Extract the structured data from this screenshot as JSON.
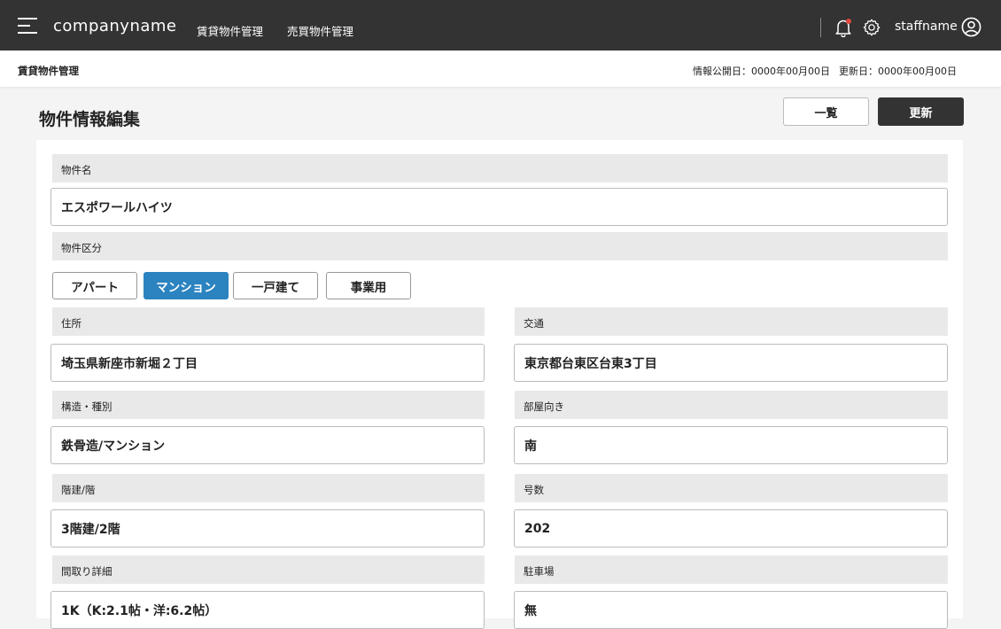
{
  "header": {
    "brand": "companyname",
    "nav": [
      "賃貸物件管理",
      "売買物件管理"
    ],
    "staff_name": "staffname"
  },
  "subheader": {
    "breadcrumb": "賃貸物件管理",
    "published": "情報公開日：0000年00月00日",
    "updated": "更新日：0000年00月00日"
  },
  "page": {
    "title": "物件情報編集",
    "list_button": "一覧",
    "update_button": "更新"
  },
  "form": {
    "name_label": "物件名",
    "name_value": "エスポワールハイツ",
    "type_label": "物件区分",
    "type_options": [
      "アパート",
      "マンション",
      "一戸建て",
      "事業用"
    ],
    "type_selected": "マンション",
    "address_label": "住所",
    "address_value": "埼玉県新座市新堀２丁目",
    "traffic_label": "交通",
    "traffic_value": "東京都台東区台東3丁目",
    "structure_label": "構造・種別",
    "structure_value": "鉄骨造/マンション",
    "direction_label": "部屋向き",
    "direction_value": "南",
    "floors_label": "階建/階",
    "floors_value": "3階建/2階",
    "room_no_label": "号数",
    "room_no_value": "202",
    "layout_label": "間取り詳細",
    "layout_value": "1K（K:2.1帖・洋:6.2帖）",
    "parking_label": "駐車場",
    "parking_value": "無"
  },
  "colors": {
    "topbar": "#333333",
    "accent": "#2b83c0",
    "label_bg": "#e9e9e9",
    "notification_dot": "#e2473a"
  },
  "icons": [
    "menu-icon",
    "bell-icon",
    "gear-icon",
    "user-circle-icon"
  ]
}
